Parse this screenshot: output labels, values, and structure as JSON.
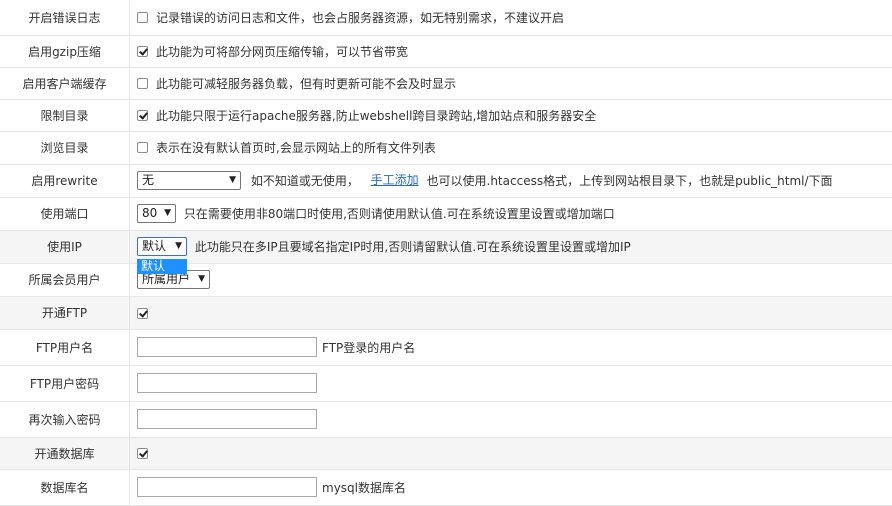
{
  "rows": [
    {
      "label": "开启错误日志",
      "checked": false,
      "desc": "记录错误的访问日志和文件，也会占服务器资源，如无特别需求，不建议开启"
    },
    {
      "label": "启用gzip压缩",
      "checked": true,
      "desc": "此功能为可将部分网页压缩传输，可以节省带宽"
    },
    {
      "label": "启用客户端缓存",
      "checked": false,
      "desc": "此功能可减轻服务器负载，但有时更新可能不会及时显示"
    },
    {
      "label": "限制目录",
      "checked": true,
      "desc": "此功能只限于运行apache服务器,防止webshell跨目录跨站,增加站点和服务器安全"
    },
    {
      "label": "浏览目录",
      "checked": false,
      "desc": "表示在没有默认首页时,会显示网站上的所有文件列表"
    }
  ],
  "rewrite": {
    "label": "启用rewrite",
    "value": "无",
    "desc1": "如不知道或无使用，",
    "link": "手工添加",
    "desc2": "也可以使用.htaccess格式，上传到网站根目录下，也就是public_html/下面"
  },
  "port": {
    "label": "使用端口",
    "value": "80",
    "desc": "只在需要使用非80端口时使用,否则请使用默认值.可在系统设置里设置或增加端口"
  },
  "ip": {
    "label": "使用IP",
    "value": "默认",
    "desc": "此功能只在多IP且要域名指定IP时用,否则请留默认值.可在系统设置里设置或增加IP",
    "option": "默认"
  },
  "member": {
    "label": "所属会员用户",
    "value": "所属用户"
  },
  "ftp": {
    "label": "开通FTP",
    "checked": true
  },
  "ftp_user": {
    "label": "FTP用户名",
    "desc": "FTP登录的用户名"
  },
  "ftp_pass": {
    "label": "FTP用户密码"
  },
  "ftp_pass2": {
    "label": "再次输入密码"
  },
  "db": {
    "label": "开通数据库",
    "checked": true
  },
  "db_name": {
    "label": "数据库名",
    "desc": "mysql数据库名"
  }
}
